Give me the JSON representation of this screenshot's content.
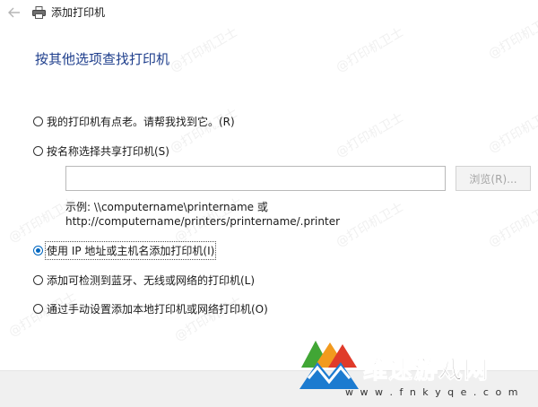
{
  "window": {
    "back_icon": "arrow-left-icon",
    "printer_icon": "printer-icon",
    "title": "添加打印机"
  },
  "heading": "按其他选项查找打印机",
  "options": [
    {
      "label": "我的打印机有点老。请帮我找到它。(R)",
      "checked": false
    },
    {
      "label": "按名称选择共享打印机(S)",
      "checked": false
    },
    {
      "label": "使用 IP 地址或主机名添加打印机(I)",
      "checked": true
    },
    {
      "label": "添加可检测到蓝牙、无线或网络的打印机(L)",
      "checked": false
    },
    {
      "label": "通过手动设置添加本地打印机或网络打印机(O)",
      "checked": false
    }
  ],
  "share": {
    "input_value": "",
    "browse_label": "浏览(R)...",
    "example_line1": "示例: \\\\computername\\printername 或",
    "example_line2": "http://computername/printers/printername/.printer"
  },
  "watermark_text": "@打印机卫士",
  "site_logo": {
    "text": "维速游戏网",
    "url": "w w w . f n k y q e . c o m",
    "colors": {
      "green": "#41a635",
      "blue": "#1c7bd0",
      "orange": "#f29a1e",
      "red": "#e03b2a"
    }
  },
  "colors": {
    "heading": "#1e3e8c",
    "radio_accent": "#0067c0",
    "disabled_text": "#a5a5a5"
  }
}
